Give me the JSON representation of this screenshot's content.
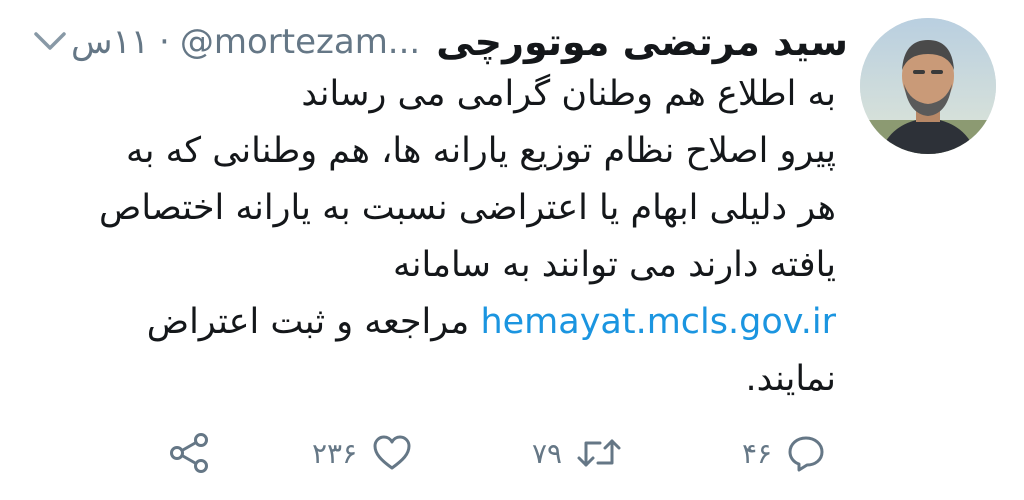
{
  "tweet": {
    "display_name": "سید مرتضی موتورچی",
    "handle": "@mortezam...",
    "separator": "·",
    "time": "۱۱س",
    "body_lines": [
      "به اطلاع هم وطنان گرامی می رساند",
      "پیرو اصلاح نظام توزیع یارانه ها، هم وطنانی که به",
      "هر دلیلی ابهام یا اعتراضی نسبت به یارانه اختصاص",
      "یافته دارند می توانند به سامانه"
    ],
    "link_line": {
      "link": "hemayat.mcls.gov.ir",
      "after": " مراجعه و ثبت اعتراض"
    },
    "last_line": "نمایند."
  },
  "actions": {
    "reply_count": "۴۶",
    "retweet_count": "۷۹",
    "like_count": "۲۳۶"
  },
  "icons": {
    "menu": "chevron-down-icon",
    "reply": "reply-icon",
    "retweet": "retweet-icon",
    "like": "heart-icon",
    "share": "share-icon"
  },
  "colors": {
    "text": "#14171a",
    "muted": "#657786",
    "link": "#1b95e0"
  }
}
